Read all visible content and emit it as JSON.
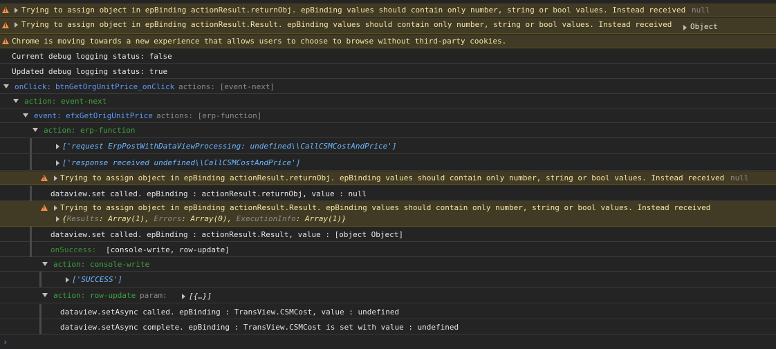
{
  "warnings": {
    "w1_text": "Trying to assign object in epBinding actionResult.returnObj. epBinding values should contain only number, string or bool values. Instead received",
    "w1_value": "null",
    "w2_text": "Trying to assign object in epBinding actionResult.Result. epBinding values should contain only number, string or bool values. Instead received",
    "w2_value": "Object",
    "chrome": "Chrome is moving towards a new experience that allows users to choose to browse without third-party cookies."
  },
  "logs": {
    "debug_current": "Current debug logging status: false",
    "debug_updated": "Updated debug logging status: true"
  },
  "tree": {
    "onclick_label": "onClick:",
    "onclick_name": "btnGetOrgUnitPrice_onClick",
    "onclick_actions": "actions: [event-next]",
    "action_event_next": "action: event-next",
    "event_label": "event:",
    "event_name": "efxGetOrigUnitPrice",
    "event_actions": "actions: [erp-function]",
    "action_erp_function": "action: erp-function",
    "req_array": "['request ErpPostWithDataViewProcessing: undefined\\\\CallCSMCostAndPrice']",
    "resp_array": "['response received undefined\\\\CallCSMCostAndPrice']",
    "inner_warn1_text": "Trying to assign object in epBinding actionResult.returnObj. epBinding values should contain only number, string or bool values. Instead received",
    "inner_warn1_value": "null",
    "dataview_set1": "dataview.set called. epBinding : actionResult.returnObj, value : null",
    "inner_warn2_text": "Trying to assign object in epBinding actionResult.Result. epBinding values should contain only number, string or bool values. Instead received",
    "obj_open": "{",
    "obj_k1": "Results",
    "obj_v1": "Array(1)",
    "obj_k2": "Errors",
    "obj_v2": "Array(0)",
    "obj_k3": "ExecutionInfo",
    "obj_v3": "Array(1)",
    "obj_close": "}",
    "dataview_set2": "dataview.set called. epBinding : actionResult.Result, value : [object Object]",
    "onsuccess_label": "onSuccess:",
    "onsuccess_value": "[console-write, row-update]",
    "action_console_write": "action: console-write",
    "success_array": "['SUCCESS']",
    "action_row_update": "action: row-update",
    "param_label": "param:",
    "param_value": "[{…}]",
    "setasync_called": "dataview.setAsync called. epBinding : TransView.CSMCost, value : undefined",
    "setasync_complete": "dataview.setAsync complete. epBinding : TransView.CSMCost is set with value : undefined"
  },
  "prompt_symbol": "›"
}
